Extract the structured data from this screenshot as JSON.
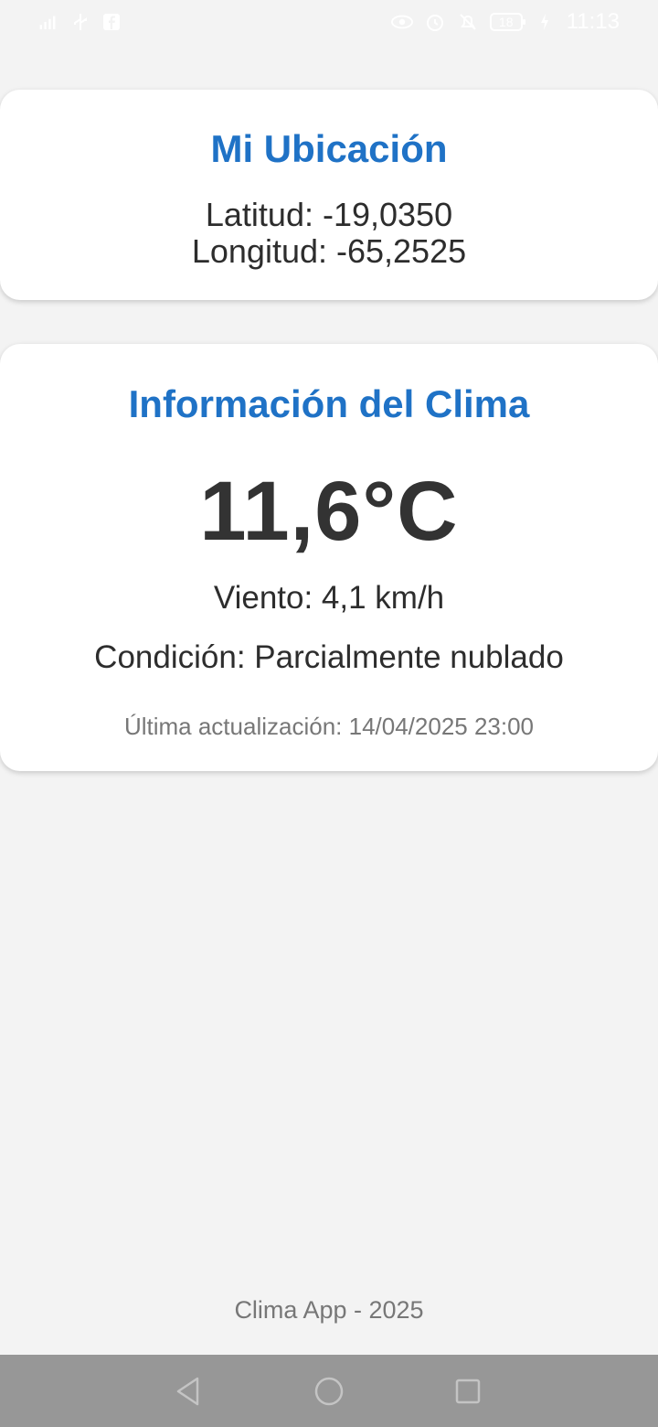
{
  "status_bar": {
    "time": "11:13",
    "battery": "18",
    "icons_left": [
      "signal-icon",
      "usb-icon",
      "facebook-icon"
    ],
    "icons_right": [
      "eye-icon",
      "alarm-icon",
      "mute-icon",
      "battery-icon",
      "charging-icon"
    ]
  },
  "location_card": {
    "title": "Mi Ubicación",
    "latitude": "Latitud: -19,0350",
    "longitude": "Longitud: -65,2525"
  },
  "weather_card": {
    "title": "Información del Clima",
    "temperature": "11,6°C",
    "wind": "Viento: 4,1 km/h",
    "condition": "Condición: Parcialmente nublado",
    "last_update": "Última actualización: 14/04/2025 23:00"
  },
  "footer": {
    "text": "Clima App - 2025"
  },
  "colors": {
    "accent": "#1f72c6",
    "background": "#f3f3f3",
    "navbar": "#979797"
  }
}
